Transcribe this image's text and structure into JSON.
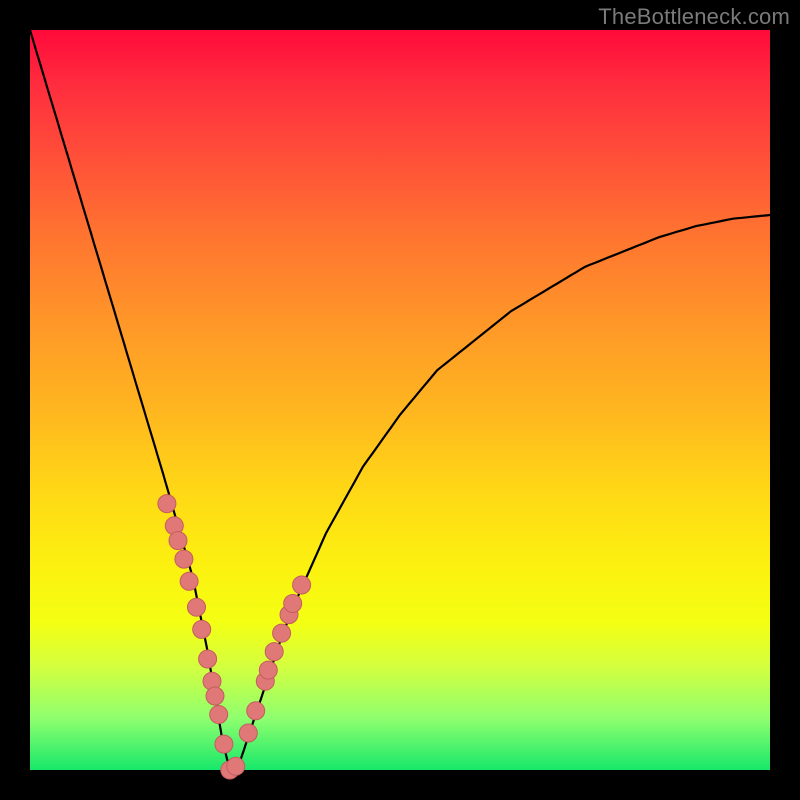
{
  "watermark": "TheBottleneck.com",
  "colors": {
    "frame": "#000000",
    "gradient_top": "#ff0a3a",
    "gradient_bottom": "#17e86a",
    "curve": "#000000",
    "marker_fill": "#e07878",
    "marker_stroke": "#c35d5d"
  },
  "chart_data": {
    "type": "line",
    "title": "",
    "xlabel": "",
    "ylabel": "",
    "xlim": [
      0,
      100
    ],
    "ylim": [
      0,
      100
    ],
    "notes": "V-shaped bottleneck curve; y ≈ percentage bottleneck, x ≈ relative hardware score. Minimum near x≈27 where y≈0. Pink markers cluster on both arms of the V between roughly y=6 and y=30.",
    "series": [
      {
        "name": "bottleneck-curve",
        "x": [
          0,
          3,
          6,
          9,
          12,
          15,
          18,
          20,
          22,
          24,
          25,
          26,
          27,
          28,
          29,
          30,
          32,
          34,
          36,
          40,
          45,
          50,
          55,
          60,
          65,
          70,
          75,
          80,
          85,
          90,
          95,
          100
        ],
        "y": [
          100,
          90,
          80,
          70,
          60,
          50,
          40,
          33,
          26,
          16,
          10,
          4,
          0,
          0,
          3,
          6,
          12,
          18,
          23,
          32,
          41,
          48,
          54,
          58,
          62,
          65,
          68,
          70,
          72,
          73.5,
          74.5,
          75
        ]
      }
    ],
    "markers": {
      "name": "highlighted-points",
      "x": [
        18.5,
        19.5,
        20.0,
        20.8,
        21.5,
        22.5,
        23.2,
        24.0,
        24.6,
        25.0,
        25.5,
        26.2,
        27.0,
        27.8,
        29.5,
        30.5,
        31.8,
        32.2,
        33.0,
        34.0,
        35.0,
        35.5,
        36.7
      ],
      "y": [
        36.0,
        33.0,
        31.0,
        28.5,
        25.5,
        22.0,
        19.0,
        15.0,
        12.0,
        10.0,
        7.5,
        3.5,
        0.0,
        0.5,
        5.0,
        8.0,
        12.0,
        13.5,
        16.0,
        18.5,
        21.0,
        22.5,
        25.0
      ]
    }
  }
}
